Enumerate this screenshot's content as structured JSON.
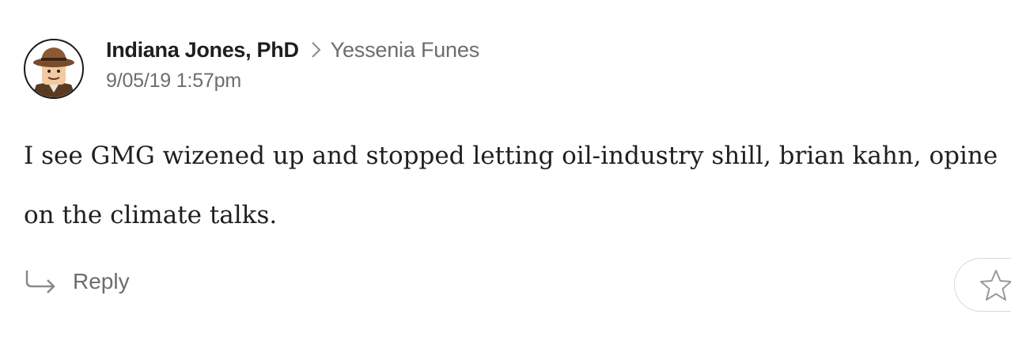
{
  "comment": {
    "author": "Indiana Jones, PhD",
    "recipient": "Yessenia Funes",
    "timestamp": "9/05/19 1:57pm",
    "body": "I see GMG wizened up and stopped letting oil-industry shill, brian kahn, opine on the climate talks.",
    "avatar_icon": "fedora-adventurer-avatar"
  },
  "actions": {
    "reply_label": "Reply",
    "reply_icon": "reply-arrow-icon",
    "star_icon": "star-icon"
  },
  "colors": {
    "author": "#1e1e1e",
    "meta": "#6d6d6d",
    "body": "#202020",
    "border": "#d8d8d8"
  }
}
